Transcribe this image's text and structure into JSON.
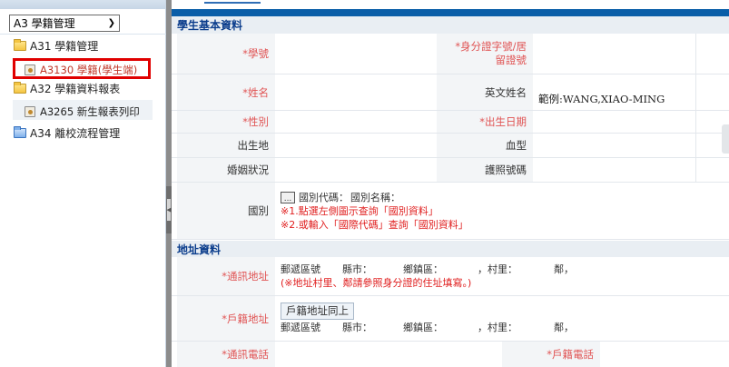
{
  "sidebar": {
    "module_select": "A3 學籍管理",
    "items": [
      {
        "label": "A31 學籍管理",
        "icon": "folder-open-icon"
      },
      {
        "label": "A3130 學籍(學生端)",
        "icon": "document-gear-icon"
      },
      {
        "label": "A32 學籍資料報表",
        "icon": "folder-open-icon"
      },
      {
        "label": "A3265 新生報表列印",
        "icon": "document-gear-icon"
      },
      {
        "label": "A34 離校流程管理",
        "icon": "folder-blue-icon"
      }
    ]
  },
  "main": {
    "basic_title": "學生基本資料",
    "address_title": "地址資料",
    "labels": {
      "student_no": "*學號",
      "id_no": "*身分證字號/居留證號",
      "name": "*姓名",
      "english_name": "英文姓名",
      "english_name_example": "範例:WANG,XIAO-MING",
      "gender": "*性別",
      "birthday": "*出生日期",
      "birthplace": "出生地",
      "blood_type": "血型",
      "marital": "婚姻狀況",
      "passport": "護照號碼",
      "nationality": "國別",
      "mailing_address": "*通訊地址",
      "household_address": "*戶籍地址",
      "mailing_phone": "*通訊電話",
      "household_phone": "*戶籍電話"
    },
    "nationality_field": {
      "picker_button": "...",
      "code_label": "國別代碼：",
      "name_label": "國別名稱：",
      "hint1": "※1.點選左側圖示查詢「國別資料」",
      "hint2": "※2.或輸入「國際代碼」查詢「國別資料」"
    },
    "address_fields": {
      "postal": "郵遞區號",
      "city": "縣市：",
      "town": "鄉鎮區：",
      "village": "，村里：",
      "neighbor": "鄰，",
      "note": "(※地址村里、鄰請參照身分證的住址填寫。)"
    },
    "copy_address_button": "戶籍地址同上",
    "colors": {
      "header_bar": "#0a5ea8",
      "section_title": "#0b3d8c",
      "required_label": "#e05454",
      "hint_text": "#e02020",
      "highlight_box": "#e00000"
    }
  }
}
